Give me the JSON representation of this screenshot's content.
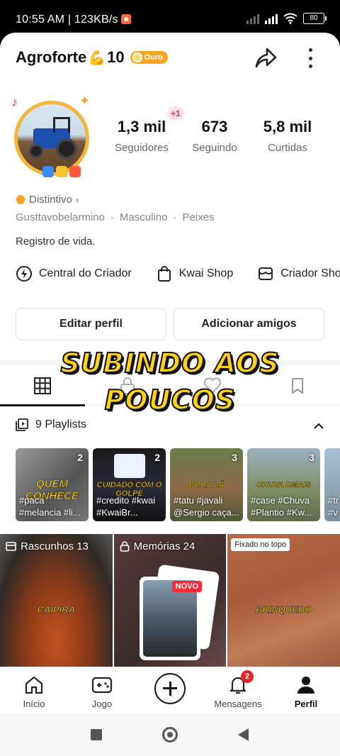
{
  "status_bar": {
    "time": "10:55 AM | 123KB/s",
    "battery": "80"
  },
  "header": {
    "username": "Agroforte",
    "emoji": "💪",
    "level": "10",
    "tier_badge": "Ouro",
    "icons": [
      "share-icon",
      "more-icon"
    ]
  },
  "profile": {
    "new_followers_badge": "+1",
    "stats": [
      {
        "value": "1,3 mil",
        "label": "Seguidores"
      },
      {
        "value": "673",
        "label": "Seguindo"
      },
      {
        "value": "5,8 mil",
        "label": "Curtidas"
      }
    ],
    "distintivo": "Distintivo",
    "tags": [
      "Gusttavobelarmino",
      "Masculino",
      "Peixes"
    ],
    "bio": "Registro de vida.",
    "links": [
      {
        "label": "Central do Criador",
        "icon": "lightning-icon"
      },
      {
        "label": "Kwai Shop",
        "icon": "bag-icon"
      },
      {
        "label": "Criador Sho",
        "icon": "shop-icon"
      }
    ],
    "buttons": {
      "edit": "Editar perfil",
      "add_friends": "Adicionar amigos"
    }
  },
  "overlay_caption": {
    "line1": "SUBINDO AOS",
    "line2": "POUCOS"
  },
  "tabs": [
    "grid-icon",
    "private-icon",
    "liked-icon",
    "bookmark-icon"
  ],
  "playlists": {
    "header": "9 Playlists",
    "items": [
      {
        "count": "2",
        "caption": "QUEM CONHECE",
        "tags_line1": "#paca",
        "tags_line2": "#melancia #li..."
      },
      {
        "count": "2",
        "caption": "CUIDADO COM O GOLPE",
        "tags_line1": "#credito #kwai",
        "tags_line2": "#KwaiBr..."
      },
      {
        "count": "3",
        "caption": "BORA LÁ",
        "tags_line1": "#tatu #javali",
        "tags_line2": "@Sergio caça..."
      },
      {
        "count": "3",
        "caption": "CHUVA DMAIS",
        "tags_line1": "#case #Chuva",
        "tags_line2": "#Plantio #Kw..."
      },
      {
        "count": "",
        "caption": "",
        "tags_line1": "#tr",
        "tags_line2": "#v"
      }
    ]
  },
  "grid": [
    {
      "label": "Rascunhos 13",
      "caption": "CAIPIRA",
      "icon": "drafts-icon"
    },
    {
      "label": "Memórias 24",
      "badge": "NOVO",
      "icon": "lock-icon"
    },
    {
      "pinned": "Fixado no topo",
      "caption": "BRINQUEDO"
    }
  ],
  "bottom_nav": [
    {
      "label": "Início",
      "icon": "home-icon"
    },
    {
      "label": "Jogo",
      "icon": "gamepad-icon"
    },
    {
      "label": "",
      "icon": "create-icon"
    },
    {
      "label": "Mensagens",
      "icon": "bell-icon",
      "badge": "2"
    },
    {
      "label": "Perfil",
      "icon": "person-icon"
    }
  ]
}
